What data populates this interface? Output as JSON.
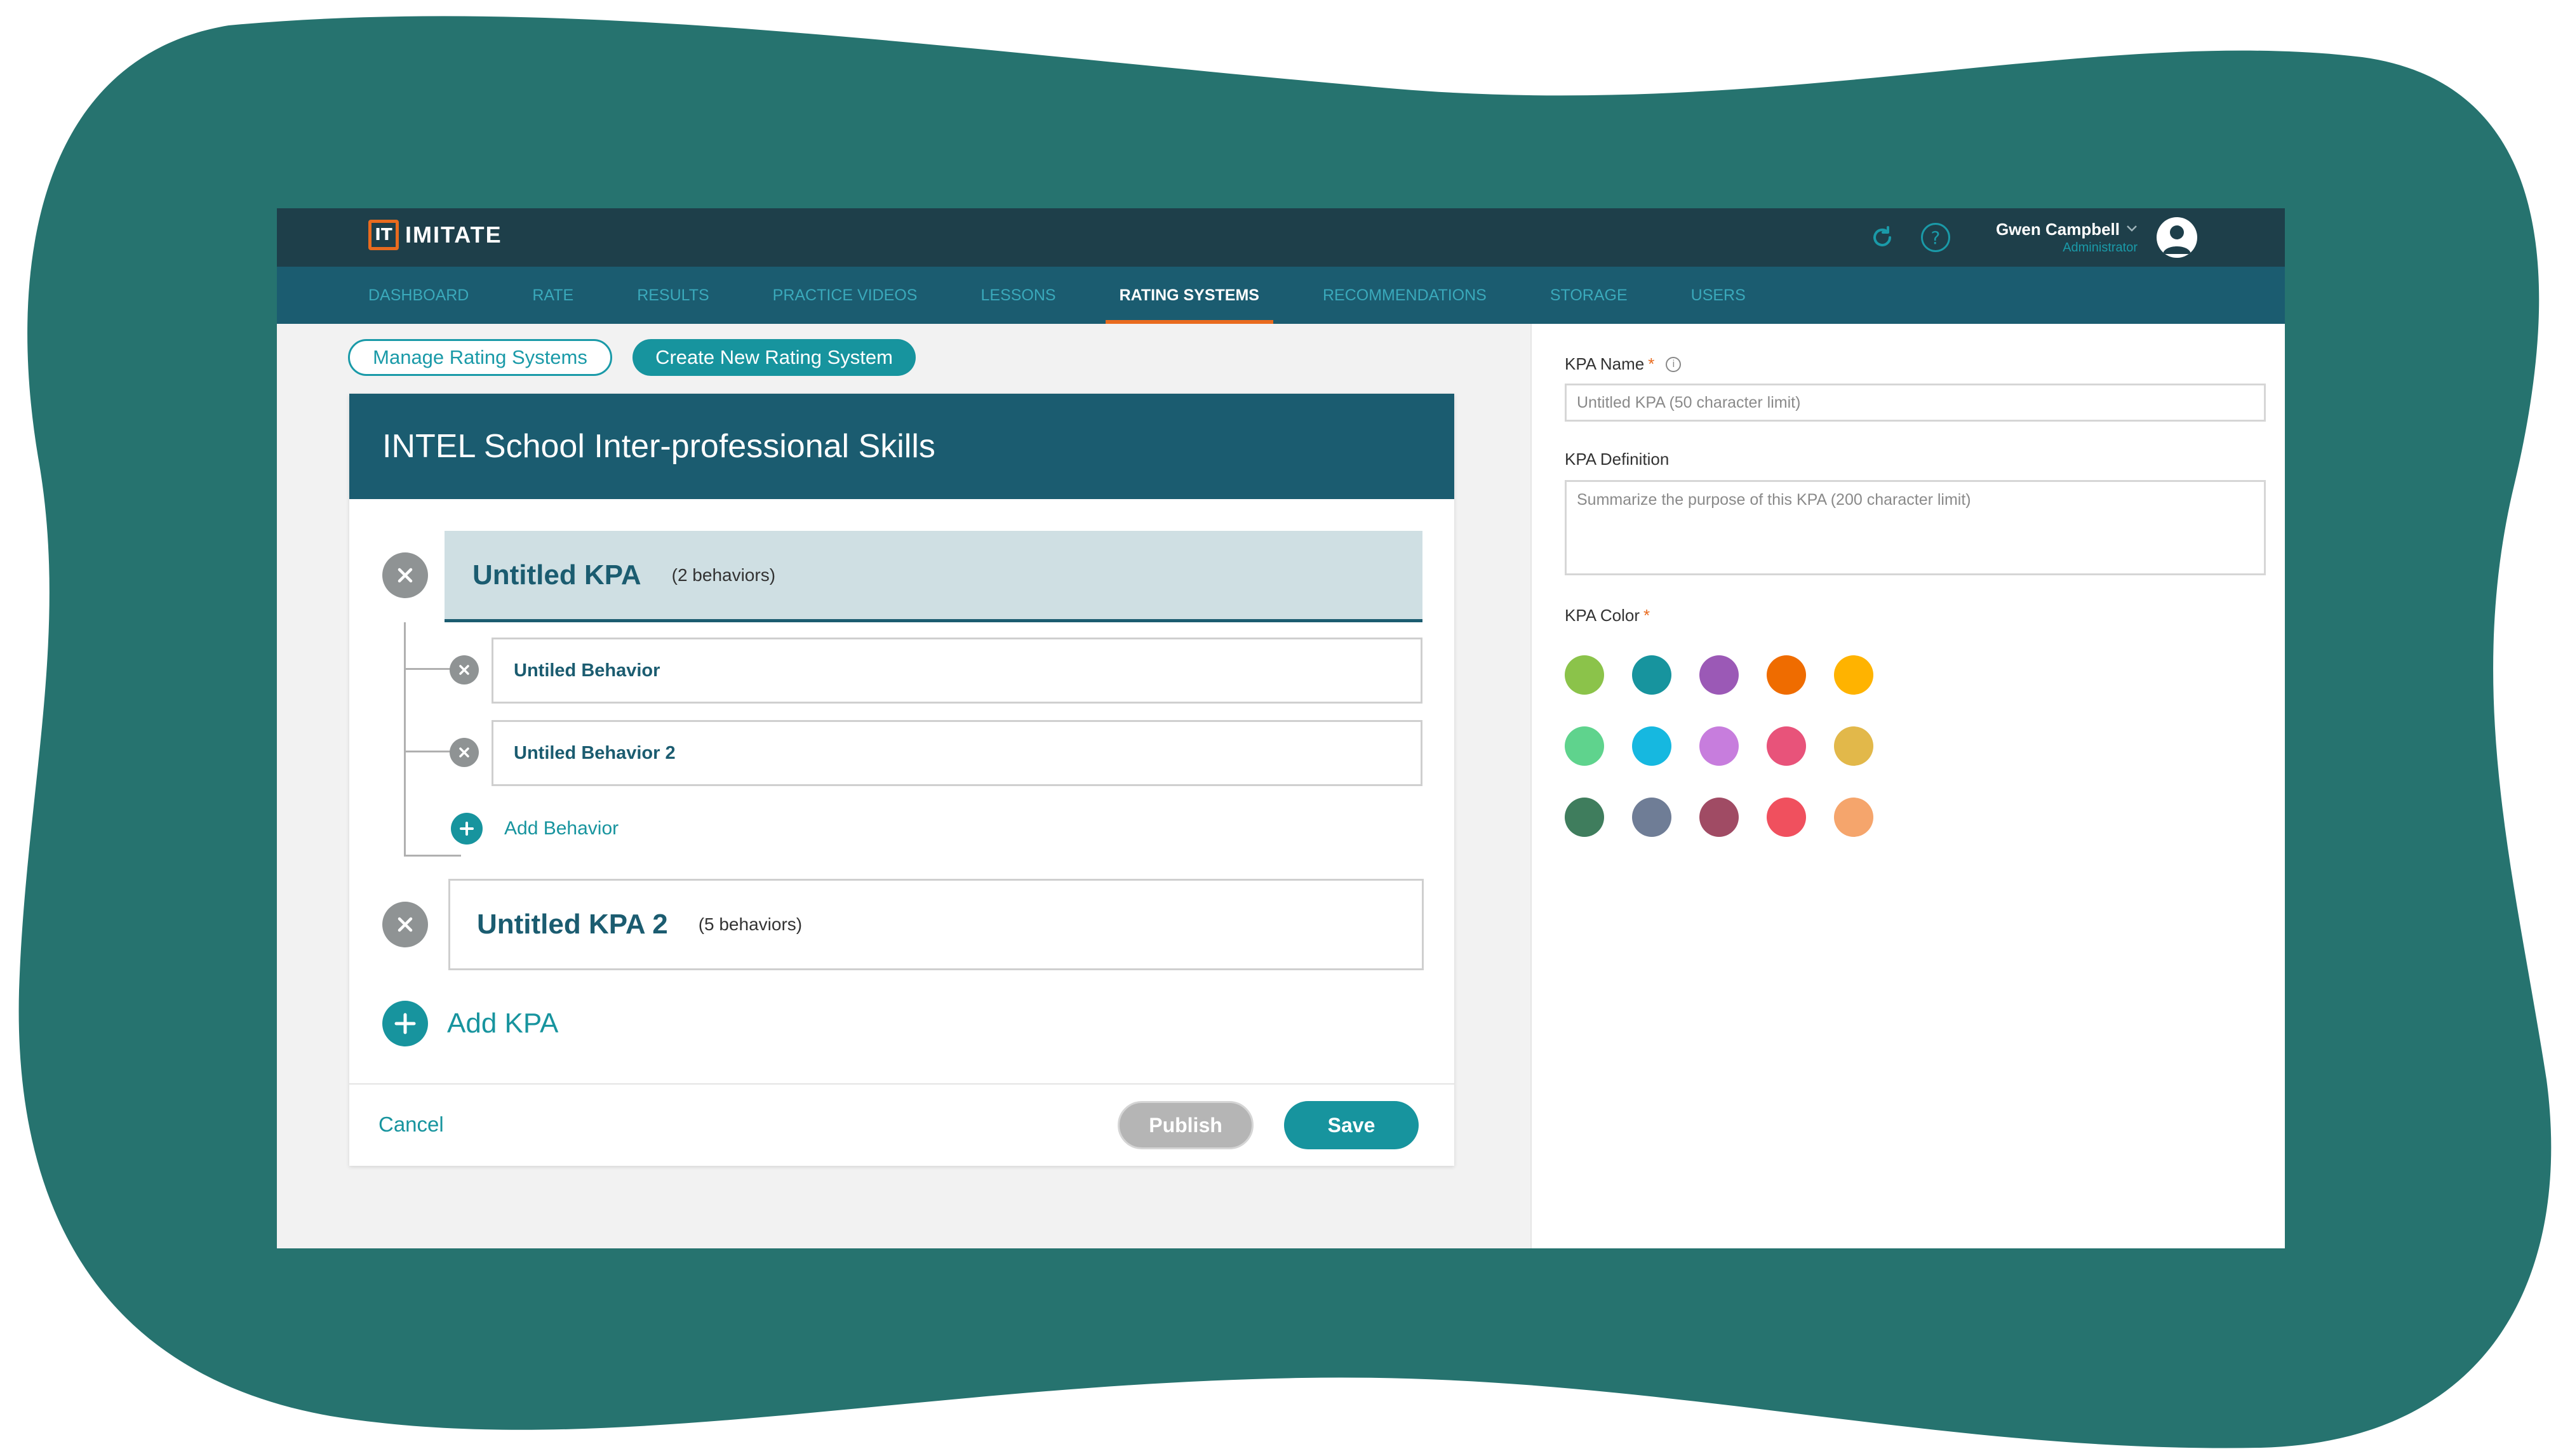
{
  "app": {
    "name": "IMITATE",
    "logo_glyph": "IT"
  },
  "user": {
    "name": "Gwen Campbell",
    "role": "Administrator"
  },
  "nav": {
    "items": [
      {
        "label": "DASHBOARD",
        "active": false
      },
      {
        "label": "RATE",
        "active": false
      },
      {
        "label": "RESULTS",
        "active": false
      },
      {
        "label": "PRACTICE VIDEOS",
        "active": false
      },
      {
        "label": "LESSONS",
        "active": false
      },
      {
        "label": "RATING SYSTEMS",
        "active": true
      },
      {
        "label": "RECOMMENDATIONS",
        "active": false
      },
      {
        "label": "STORAGE",
        "active": false
      },
      {
        "label": "USERS",
        "active": false
      }
    ]
  },
  "subnav": {
    "manage_label": "Manage Rating Systems",
    "create_label": "Create New Rating System"
  },
  "editor": {
    "title": "INTEL School Inter-professional Skills",
    "kpas": [
      {
        "title": "Untitled KPA",
        "count": "(2 behaviors)",
        "behaviors": [
          "Untiled Behavior",
          "Untiled Behavior 2"
        ]
      },
      {
        "title": "Untitled KPA 2",
        "count": "(5 behaviors)"
      }
    ],
    "add_behavior_label": "Add Behavior",
    "add_kpa_label": "Add KPA",
    "cancel_label": "Cancel",
    "publish_label": "Publish",
    "save_label": "Save"
  },
  "kpa_form": {
    "name_label": "KPA Name",
    "name_placeholder": "Untitled KPA (50 character limit)",
    "definition_label": "KPA Definition",
    "definition_placeholder": "Summarize the purpose of this KPA (200 character limit)",
    "color_label": "KPA Color",
    "required_mark": "*",
    "colors": [
      "#8bc34a",
      "#17949e",
      "#9b59b6",
      "#ef6c00",
      "#ffb300",
      "#5fd38d",
      "#16b8e0",
      "#c77ddd",
      "#e8537a",
      "#e2b84a",
      "#3f7d5d",
      "#6f7d96",
      "#a04b64",
      "#f0505e",
      "#f5a56c"
    ]
  },
  "theme": {
    "blob": "#26736f",
    "topbar": "#1e3f4a",
    "navbar": "#1b5c70",
    "accent": "#17949e",
    "active_underline": "#e96b1f"
  }
}
